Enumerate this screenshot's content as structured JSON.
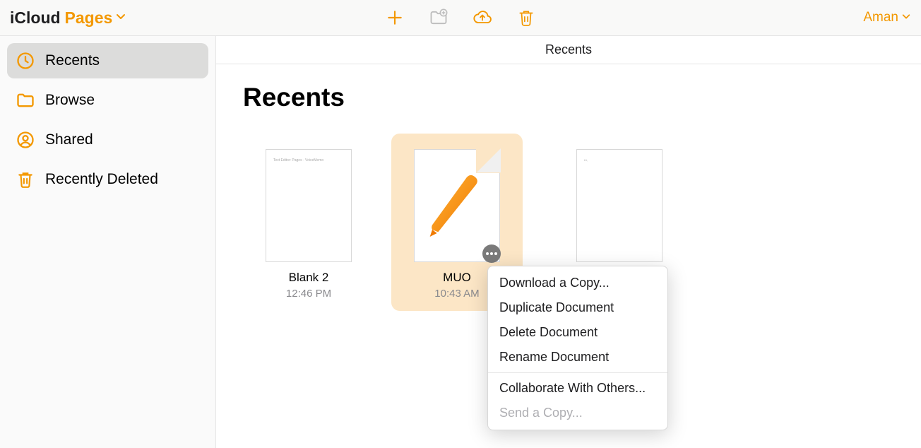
{
  "header": {
    "icloud_label": "iCloud",
    "app_label": "Pages",
    "user_label": "Aman"
  },
  "sidebar": {
    "items": [
      {
        "label": "Recents",
        "icon": "clock",
        "selected": true
      },
      {
        "label": "Browse",
        "icon": "folder",
        "selected": false
      },
      {
        "label": "Shared",
        "icon": "person-circle",
        "selected": false
      },
      {
        "label": "Recently Deleted",
        "icon": "trash",
        "selected": false
      }
    ]
  },
  "content": {
    "header_title": "Recents",
    "page_title": "Recents"
  },
  "documents": [
    {
      "name": "Blank 2",
      "time": "12:46 PM",
      "selected": false,
      "has_pen_icon": false
    },
    {
      "name": "MUO",
      "time": "10:43 AM",
      "selected": true,
      "has_pen_icon": true
    },
    {
      "name": "",
      "time": "",
      "selected": false,
      "has_pen_icon": false
    }
  ],
  "context_menu": {
    "items": [
      {
        "label": "Download a Copy...",
        "disabled": false
      },
      {
        "label": "Duplicate Document",
        "disabled": false
      },
      {
        "label": "Delete Document",
        "disabled": false
      },
      {
        "label": "Rename Document",
        "disabled": false
      }
    ],
    "items2": [
      {
        "label": "Collaborate With Others...",
        "disabled": false
      },
      {
        "label": "Send a Copy...",
        "disabled": true
      }
    ]
  }
}
